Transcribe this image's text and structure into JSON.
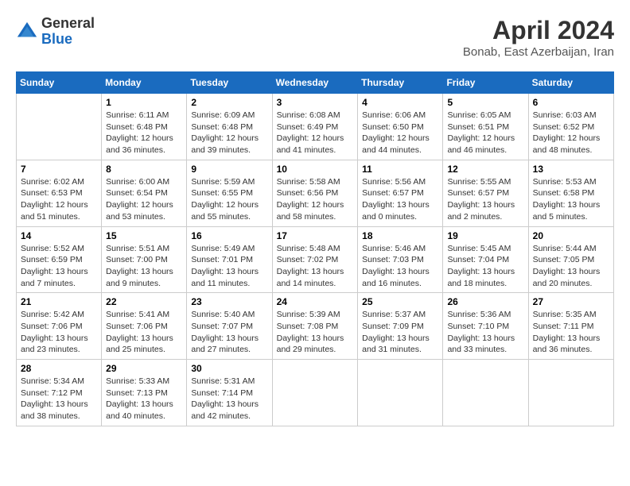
{
  "header": {
    "logo_general": "General",
    "logo_blue": "Blue",
    "title": "April 2024",
    "location": "Bonab, East Azerbaijan, Iran"
  },
  "calendar": {
    "days_of_week": [
      "Sunday",
      "Monday",
      "Tuesday",
      "Wednesday",
      "Thursday",
      "Friday",
      "Saturday"
    ],
    "weeks": [
      [
        {
          "day": "",
          "info": ""
        },
        {
          "day": "1",
          "info": "Sunrise: 6:11 AM\nSunset: 6:48 PM\nDaylight: 12 hours\nand 36 minutes."
        },
        {
          "day": "2",
          "info": "Sunrise: 6:09 AM\nSunset: 6:48 PM\nDaylight: 12 hours\nand 39 minutes."
        },
        {
          "day": "3",
          "info": "Sunrise: 6:08 AM\nSunset: 6:49 PM\nDaylight: 12 hours\nand 41 minutes."
        },
        {
          "day": "4",
          "info": "Sunrise: 6:06 AM\nSunset: 6:50 PM\nDaylight: 12 hours\nand 44 minutes."
        },
        {
          "day": "5",
          "info": "Sunrise: 6:05 AM\nSunset: 6:51 PM\nDaylight: 12 hours\nand 46 minutes."
        },
        {
          "day": "6",
          "info": "Sunrise: 6:03 AM\nSunset: 6:52 PM\nDaylight: 12 hours\nand 48 minutes."
        }
      ],
      [
        {
          "day": "7",
          "info": "Sunrise: 6:02 AM\nSunset: 6:53 PM\nDaylight: 12 hours\nand 51 minutes."
        },
        {
          "day": "8",
          "info": "Sunrise: 6:00 AM\nSunset: 6:54 PM\nDaylight: 12 hours\nand 53 minutes."
        },
        {
          "day": "9",
          "info": "Sunrise: 5:59 AM\nSunset: 6:55 PM\nDaylight: 12 hours\nand 55 minutes."
        },
        {
          "day": "10",
          "info": "Sunrise: 5:58 AM\nSunset: 6:56 PM\nDaylight: 12 hours\nand 58 minutes."
        },
        {
          "day": "11",
          "info": "Sunrise: 5:56 AM\nSunset: 6:57 PM\nDaylight: 13 hours\nand 0 minutes."
        },
        {
          "day": "12",
          "info": "Sunrise: 5:55 AM\nSunset: 6:57 PM\nDaylight: 13 hours\nand 2 minutes."
        },
        {
          "day": "13",
          "info": "Sunrise: 5:53 AM\nSunset: 6:58 PM\nDaylight: 13 hours\nand 5 minutes."
        }
      ],
      [
        {
          "day": "14",
          "info": "Sunrise: 5:52 AM\nSunset: 6:59 PM\nDaylight: 13 hours\nand 7 minutes."
        },
        {
          "day": "15",
          "info": "Sunrise: 5:51 AM\nSunset: 7:00 PM\nDaylight: 13 hours\nand 9 minutes."
        },
        {
          "day": "16",
          "info": "Sunrise: 5:49 AM\nSunset: 7:01 PM\nDaylight: 13 hours\nand 11 minutes."
        },
        {
          "day": "17",
          "info": "Sunrise: 5:48 AM\nSunset: 7:02 PM\nDaylight: 13 hours\nand 14 minutes."
        },
        {
          "day": "18",
          "info": "Sunrise: 5:46 AM\nSunset: 7:03 PM\nDaylight: 13 hours\nand 16 minutes."
        },
        {
          "day": "19",
          "info": "Sunrise: 5:45 AM\nSunset: 7:04 PM\nDaylight: 13 hours\nand 18 minutes."
        },
        {
          "day": "20",
          "info": "Sunrise: 5:44 AM\nSunset: 7:05 PM\nDaylight: 13 hours\nand 20 minutes."
        }
      ],
      [
        {
          "day": "21",
          "info": "Sunrise: 5:42 AM\nSunset: 7:06 PM\nDaylight: 13 hours\nand 23 minutes."
        },
        {
          "day": "22",
          "info": "Sunrise: 5:41 AM\nSunset: 7:06 PM\nDaylight: 13 hours\nand 25 minutes."
        },
        {
          "day": "23",
          "info": "Sunrise: 5:40 AM\nSunset: 7:07 PM\nDaylight: 13 hours\nand 27 minutes."
        },
        {
          "day": "24",
          "info": "Sunrise: 5:39 AM\nSunset: 7:08 PM\nDaylight: 13 hours\nand 29 minutes."
        },
        {
          "day": "25",
          "info": "Sunrise: 5:37 AM\nSunset: 7:09 PM\nDaylight: 13 hours\nand 31 minutes."
        },
        {
          "day": "26",
          "info": "Sunrise: 5:36 AM\nSunset: 7:10 PM\nDaylight: 13 hours\nand 33 minutes."
        },
        {
          "day": "27",
          "info": "Sunrise: 5:35 AM\nSunset: 7:11 PM\nDaylight: 13 hours\nand 36 minutes."
        }
      ],
      [
        {
          "day": "28",
          "info": "Sunrise: 5:34 AM\nSunset: 7:12 PM\nDaylight: 13 hours\nand 38 minutes."
        },
        {
          "day": "29",
          "info": "Sunrise: 5:33 AM\nSunset: 7:13 PM\nDaylight: 13 hours\nand 40 minutes."
        },
        {
          "day": "30",
          "info": "Sunrise: 5:31 AM\nSunset: 7:14 PM\nDaylight: 13 hours\nand 42 minutes."
        },
        {
          "day": "",
          "info": ""
        },
        {
          "day": "",
          "info": ""
        },
        {
          "day": "",
          "info": ""
        },
        {
          "day": "",
          "info": ""
        }
      ]
    ]
  }
}
